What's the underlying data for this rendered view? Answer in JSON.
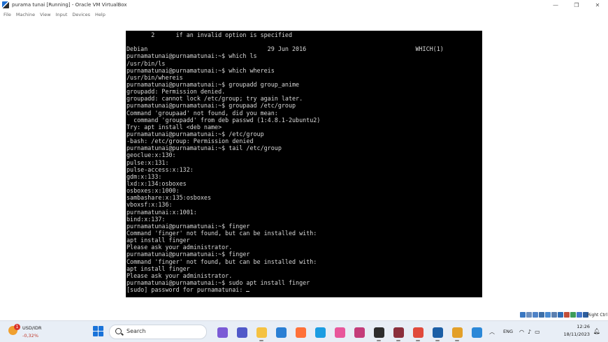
{
  "window": {
    "title": "purama tunai [Running] - Oracle VM VirtualBox",
    "controls": [
      "—",
      "❐",
      "✕"
    ]
  },
  "menu": [
    "File",
    "Machine",
    "View",
    "Input",
    "Devices",
    "Help"
  ],
  "terminal": {
    "lines": [
      "       2      if an invalid option is specified",
      "",
      "Debian                                  29 Jun 2016                               WHICH(1)",
      "purnamatunai@purnamatunai:~$ which ls",
      "/usr/bin/ls",
      "purnamatunai@purnamatunai:~$ which whereis",
      "/usr/bin/whereis",
      "purnamatunai@purnamatunai:~$ groupadd group_anime",
      "groupadd: Permission denied.",
      "groupadd: cannot lock /etc/group; try again later.",
      "purnamatunai@purnamatunai:~$ groupaad /etc/group",
      "Command 'groupaad' not found, did you mean:",
      "  command 'groupadd' from deb passwd (1:4.8.1-2ubuntu2)",
      "Try: apt install <deb name>",
      "purnamatunai@purnamatunai:~$ /etc/group",
      "-bash: /etc/group: Permission denied",
      "purnamatunai@purnamatunai:~$ tail /etc/group",
      "geoclue:x:130:",
      "pulse:x:131:",
      "pulse-access:x:132:",
      "gdm:x:133:",
      "lxd:x:134:osboxes",
      "osboxes:x:1000:",
      "sambashare:x:135:osboxes",
      "vboxsf:x:136:",
      "purnamatunai:x:1001:",
      "bind:x:137:",
      "purnamatunai@purnamatunai:~$ finger",
      "Command 'finger' not found, but can be installed with:",
      "apt install finger",
      "Please ask your administrator.",
      "purnamatunai@purnamatunai:~$ finger",
      "Command 'finger' not found, but can be installed with:",
      "apt install finger",
      "Please ask your administrator.",
      "purnamatunai@purnamatunai:~$ sudo apt install finger",
      "[sudo] password for purnamatunai: "
    ]
  },
  "statusbar": {
    "host_key": "Right Ctrl",
    "icons": [
      "hard-disk-icon",
      "optical-drive-icon",
      "audio-icon",
      "network-icon",
      "usb-icon",
      "shared-folders-icon",
      "display-icon",
      "recording-icon",
      "cpu-icon",
      "mouse-integration-icon",
      "keyboard-icon"
    ]
  },
  "taskbar": {
    "weather_badge": "1",
    "ticker_name": "USD/IDR",
    "ticker_change": "-0,32%",
    "search_label": "Search",
    "pinned": [
      {
        "name": "copilot-icon",
        "color": "#7b5bd6"
      },
      {
        "name": "teams-icon",
        "color": "#5059c9"
      },
      {
        "name": "file-explorer-icon",
        "color": "#f5c242"
      },
      {
        "name": "store-icon",
        "color": "#2a7fd4"
      },
      {
        "name": "firefox-icon",
        "color": "#ff7139"
      },
      {
        "name": "edge-icon",
        "color": "#1b9de2"
      },
      {
        "name": "snipping-tool-icon",
        "color": "#e8579b"
      },
      {
        "name": "word-icon",
        "color": "#c43d7a"
      },
      {
        "name": "terminal-icon",
        "color": "#2d2d2d"
      },
      {
        "name": "winrar-icon",
        "color": "#8b2f3c"
      },
      {
        "name": "chrome-icon",
        "color": "#e04a3c"
      },
      {
        "name": "virtualbox-icon",
        "color": "#1c5fa6"
      },
      {
        "name": "virtualbox-vm-icon",
        "color": "#e3a029"
      },
      {
        "name": "paint-icon",
        "color": "#2b88d8"
      }
    ],
    "language": "ENG",
    "time": "12:26",
    "date": "18/11/2023"
  }
}
